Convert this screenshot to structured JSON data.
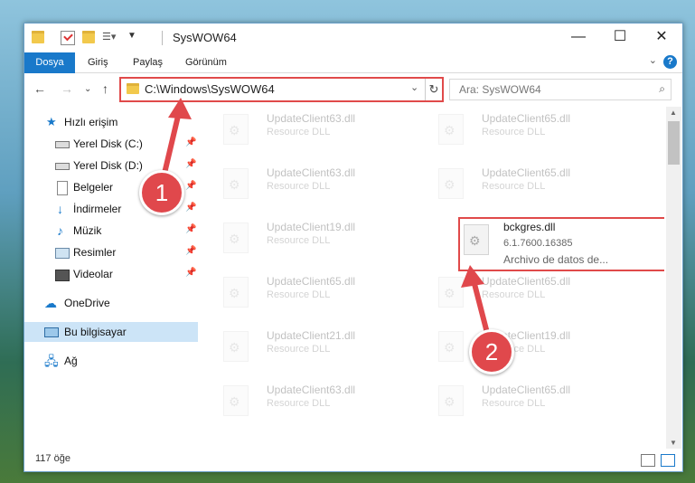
{
  "window": {
    "title": "SysWOW64",
    "controls": {
      "minimize": "—",
      "maximize": "☐",
      "close": "✕"
    }
  },
  "ribbon": {
    "tabs": [
      "Dosya",
      "Giriş",
      "Paylaş",
      "Görünüm"
    ],
    "help": "?"
  },
  "nav": {
    "address": "C:\\Windows\\SysWOW64",
    "search_placeholder": "Ara: SysWOW64"
  },
  "sidebar": {
    "items": [
      {
        "label": "Hızlı erişim",
        "icon": "star-icon"
      },
      {
        "label": "Yerel Disk (C:)",
        "icon": "disk-icon",
        "pinned": true
      },
      {
        "label": "Yerel Disk (D:)",
        "icon": "disk-icon",
        "pinned": true
      },
      {
        "label": "Belgeler",
        "icon": "documents-icon",
        "pinned": true
      },
      {
        "label": "İndirmeler",
        "icon": "downloads-icon",
        "pinned": true
      },
      {
        "label": "Müzik",
        "icon": "music-icon",
        "pinned": true
      },
      {
        "label": "Resimler",
        "icon": "pictures-icon",
        "pinned": true
      },
      {
        "label": "Videolar",
        "icon": "videos-icon",
        "pinned": true
      },
      {
        "label": "OneDrive",
        "icon": "cloud-icon"
      },
      {
        "label": "Bu bilgisayar",
        "icon": "computer-icon",
        "selected": true
      },
      {
        "label": "Ağ",
        "icon": "network-icon"
      }
    ]
  },
  "files": [
    {
      "name": "UpdateClient63.dll",
      "type": "Resource DLL"
    },
    {
      "name": "UpdateClient65.dll",
      "type": "Resource DLL"
    },
    {
      "name": "UpdateClient63.dll",
      "type": "Resource DLL"
    },
    {
      "name": "UpdateClient65.dll",
      "type": "Resource DLL"
    },
    {
      "name": "UpdateClient19.dll",
      "type": "Resource DLL"
    },
    {
      "name": "bckgres.dll",
      "version": "6.1.7600.16385",
      "type": "Archivo de datos de...",
      "highlighted": true
    },
    {
      "name": "UpdateClient65.dll",
      "type": "Resource DLL"
    },
    {
      "name": "UpdateClient65.dll",
      "type": "Resource DLL"
    },
    {
      "name": "UpdateClient21.dll",
      "type": "Resource DLL"
    },
    {
      "name": "UpdateClient19.dll",
      "type": "Resource DLL"
    },
    {
      "name": "UpdateClient63.dll",
      "type": "Resource DLL"
    },
    {
      "name": "UpdateClient65.dll",
      "type": "Resource DLL"
    }
  ],
  "status": {
    "count": "117 öğe"
  },
  "callouts": {
    "one": "1",
    "two": "2"
  },
  "colors": {
    "accent": "#1979ca",
    "highlight": "#e04a4a"
  }
}
